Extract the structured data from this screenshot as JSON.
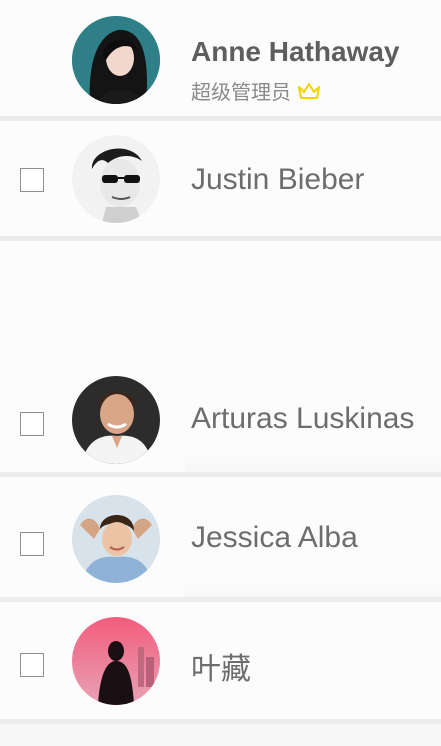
{
  "admin": {
    "name": "Anne Hathaway",
    "role": "超级管理员",
    "role_icon": "crown-icon",
    "avatar": "avatar-anne-hathaway"
  },
  "members": [
    {
      "name": "Justin Bieber",
      "checked": false,
      "avatar": "avatar-justin-bieber"
    },
    {
      "name": "Arturas Luskinas",
      "checked": false,
      "avatar": "avatar-arturas-luskinas"
    },
    {
      "name": "Jessica Alba",
      "checked": false,
      "avatar": "avatar-jessica-alba"
    },
    {
      "name": "叶藏",
      "checked": false,
      "avatar": "avatar-ye-zang"
    }
  ],
  "colors": {
    "crown": "#f5d200",
    "text": "#6d6d6d",
    "divider": "#ececec",
    "background": "#fcfcfc"
  }
}
